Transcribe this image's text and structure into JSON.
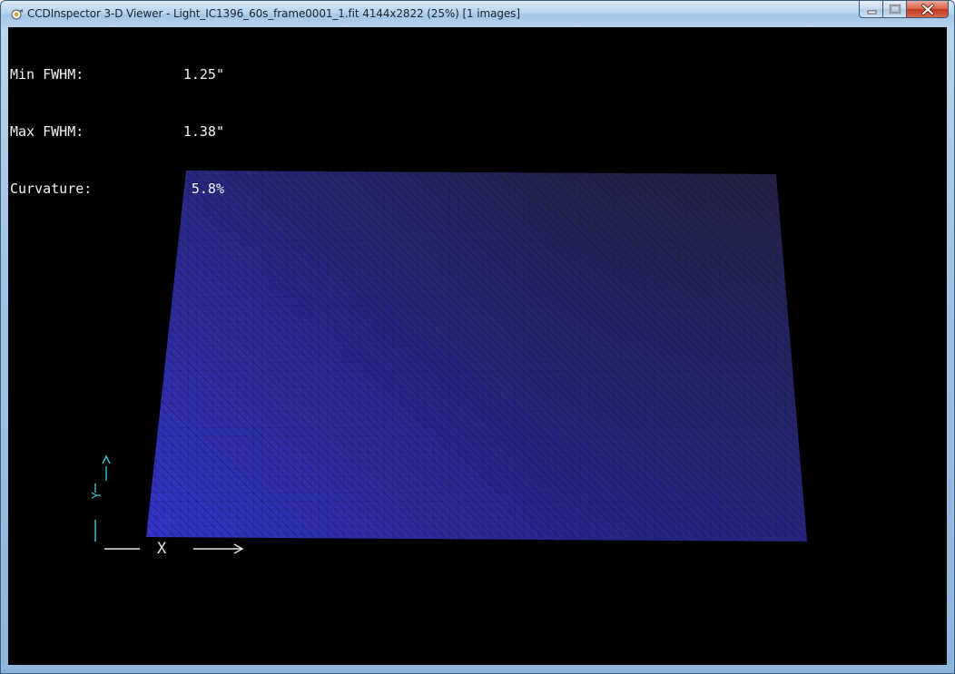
{
  "window": {
    "title": "CCDInspector 3-D Viewer - Light_IC1396_60s_frame0001_1.fit 4144x2822 (25%)  [1 images]",
    "app_icon": "ccdinspector-app-icon",
    "buttons": {
      "minimize_icon": "minimize-icon",
      "maximize_icon": "maximize-icon",
      "close_icon": "close-icon"
    }
  },
  "stats": {
    "min_fwhm_label": "Min FWHM:",
    "min_fwhm_value": "1.25\"",
    "max_fwhm_label": "Max FWHM:",
    "max_fwhm_value": "1.38\"",
    "curvature_label": "Curvature:",
    "curvature_value": "5.8%"
  },
  "axes": {
    "x_label": "X",
    "y_label": "Y",
    "x_axis_color": "#e6e6e6",
    "y_axis_color": "#35c7d4"
  },
  "surface": {
    "color_bright": "#3030c8",
    "color_dark": "#202040",
    "grid_color": "#0c0c30"
  },
  "colors": {
    "background": "#000000",
    "text": "#f2f2f2"
  }
}
